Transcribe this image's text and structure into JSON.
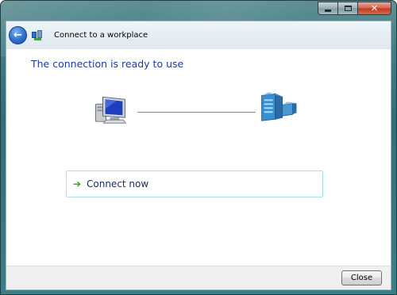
{
  "window": {
    "title": "Connect to a workplace",
    "caption_buttons": {
      "minimize_icon": "minimize-icon",
      "maximize_icon": "maximize-icon",
      "close_icon": "close-icon",
      "close_glyph": "✕"
    }
  },
  "nav": {
    "back_glyph": "←",
    "back_icon": "back-arrow-icon",
    "app_icon": "network-wizard-icon"
  },
  "main": {
    "heading": "The connection is ready to use",
    "illustration": {
      "left_icon": "computer-icon",
      "right_icon": "server-icon"
    },
    "connect_option": {
      "arrow_glyph": "➔",
      "label": "Connect now"
    }
  },
  "footer": {
    "close_label": "Close"
  },
  "colors": {
    "heading": "#1e3aa0",
    "option_border": "#a9dfe8",
    "arrow": "#2f9a2c",
    "frame": "#3f7d86"
  }
}
